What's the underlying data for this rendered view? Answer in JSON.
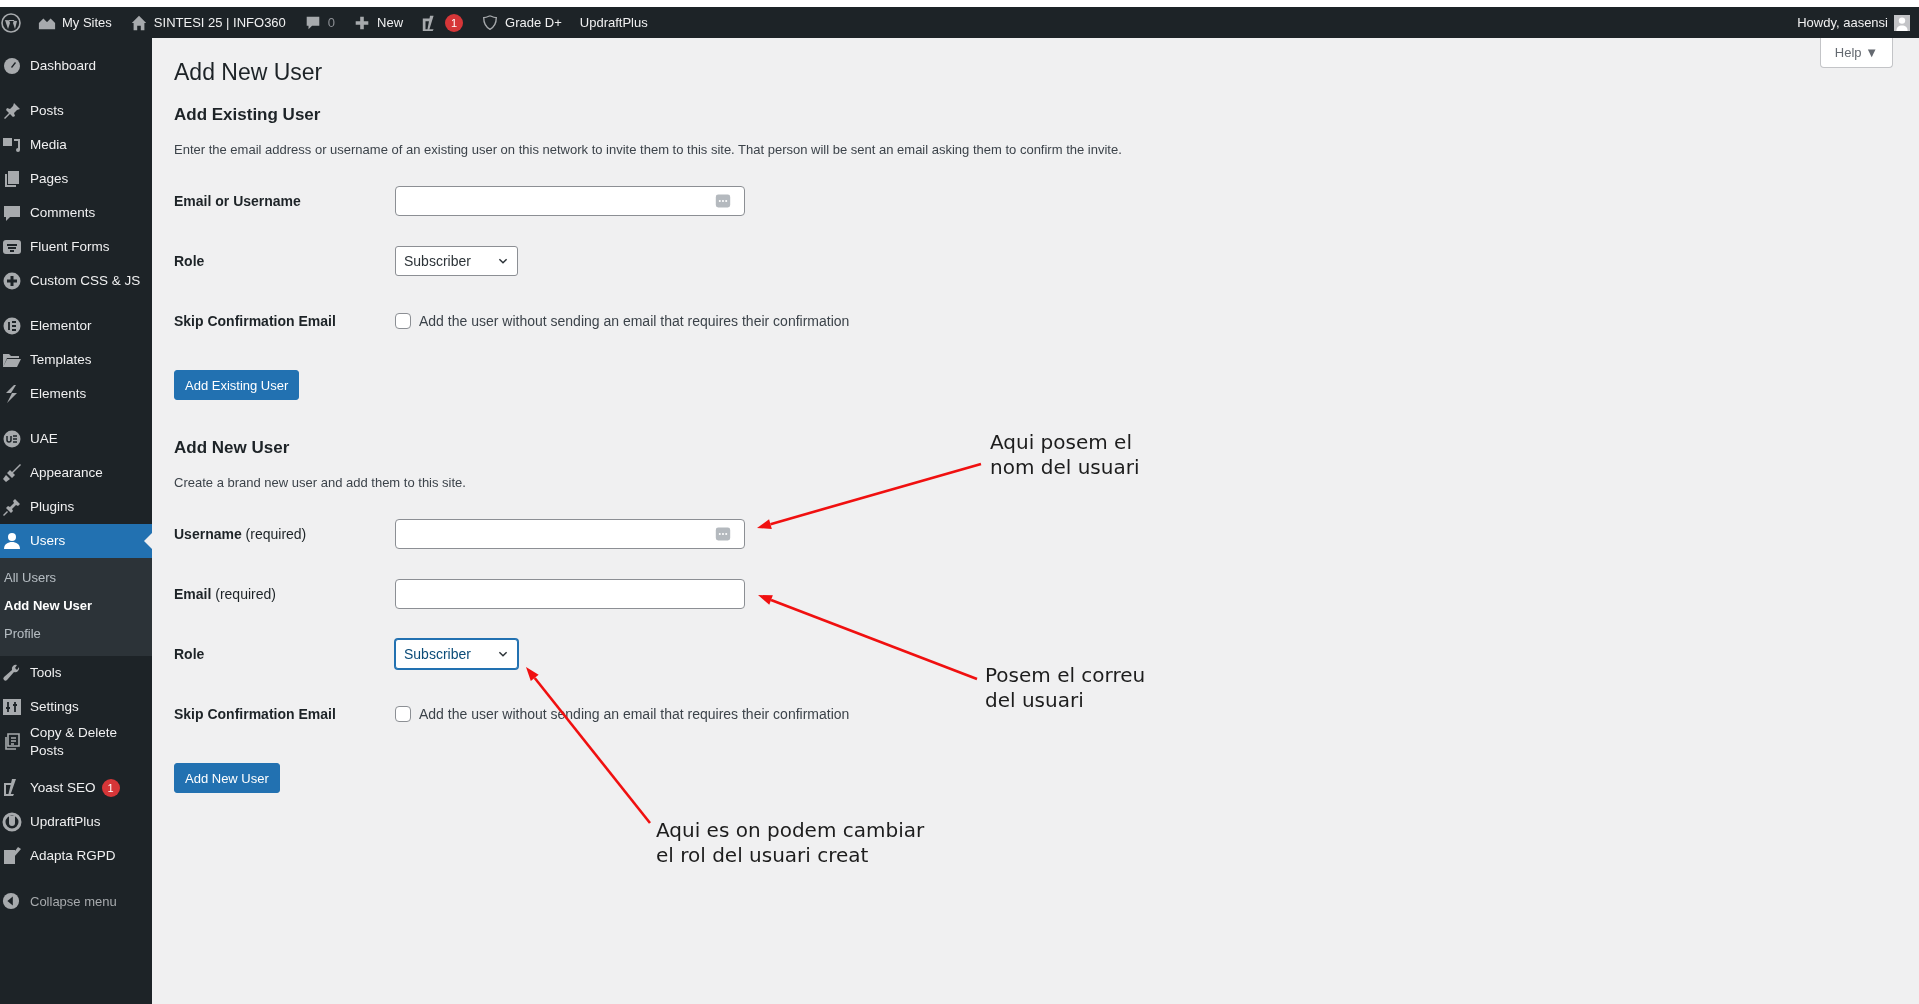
{
  "admin_bar": {
    "items": [
      {
        "kind": "logo"
      },
      {
        "kind": "link",
        "label": "My Sites"
      },
      {
        "kind": "link",
        "label": "SINTESI 25 | INFO360"
      },
      {
        "kind": "count",
        "label": "0"
      },
      {
        "kind": "link",
        "label": "New"
      },
      {
        "kind": "badge",
        "badge": "1"
      },
      {
        "kind": "link",
        "label": "Grade D+"
      },
      {
        "kind": "text",
        "label": "UpdraftPlus"
      }
    ],
    "account": "Howdy, aasensi"
  },
  "help_button": "Help ▼",
  "sidebar": {
    "groups": [
      {
        "items": [
          {
            "label": "Dashboard",
            "selected": false
          }
        ]
      },
      {
        "items": [
          {
            "label": "Posts",
            "selected": false
          },
          {
            "label": "Media",
            "selected": false
          },
          {
            "label": "Pages",
            "selected": false
          },
          {
            "label": "Comments",
            "selected": false
          },
          {
            "label": "Fluent Forms",
            "selected": false
          },
          {
            "label": "Custom CSS & JS",
            "selected": false
          }
        ]
      },
      {
        "items": [
          {
            "label": "Elementor",
            "selected": false
          },
          {
            "label": "Templates",
            "selected": false
          },
          {
            "label": "Elements",
            "selected": false
          }
        ]
      },
      {
        "items": [
          {
            "label": "UAE",
            "selected": false
          },
          {
            "label": "Appearance",
            "selected": false
          },
          {
            "label": "Plugins",
            "selected": false
          },
          {
            "label": "Users",
            "selected": true,
            "children": [
              {
                "label": "All Users",
                "selected": false
              },
              {
                "label": "Add New User",
                "selected": true
              },
              {
                "label": "Profile",
                "selected": false
              }
            ]
          },
          {
            "label": "Tools",
            "selected": false
          },
          {
            "label": "Settings",
            "selected": false
          },
          {
            "label": "Copy & Delete Posts",
            "selected": false
          }
        ]
      },
      {
        "items": [
          {
            "label": "Yoast SEO",
            "selected": false,
            "badge": "1"
          },
          {
            "label": "UpdraftPlus",
            "selected": false
          },
          {
            "label": "Adapta RGPD",
            "selected": false
          }
        ]
      }
    ],
    "collapse": "Collapse menu"
  },
  "page_title": "Add New User",
  "sections": [
    {
      "heading": "Add Existing User",
      "description": "Enter the email address or username of an existing user on this network to invite them to this site. That person will be sent an email asking them to confirm the invite.",
      "fields": [
        {
          "kind": "text",
          "label": "Email or Username",
          "dots": true
        },
        {
          "kind": "select",
          "label": "Role",
          "value": "Subscriber",
          "focused": false
        },
        {
          "kind": "checkbox",
          "label": "Skip Confirmation Email",
          "option": "Add the user without sending an email that requires their confirmation",
          "checked": false
        }
      ],
      "button": "Add Existing User"
    },
    {
      "heading": "Add New User",
      "description": "Create a brand new user and add them to this site.",
      "fields": [
        {
          "kind": "text",
          "label": "Username",
          "note": "(required)",
          "dots": true
        },
        {
          "kind": "text",
          "label": "Email",
          "note": "(required)",
          "dots": false
        },
        {
          "kind": "select",
          "label": "Role",
          "value": "Subscriber",
          "focused": true
        },
        {
          "kind": "checkbox",
          "label": "Skip Confirmation Email",
          "option": "Add the user without sending an email that requires their confirmation",
          "checked": false
        }
      ],
      "button": "Add New User"
    }
  ],
  "annotations": [
    {
      "text": "Aqui posem el\nnom del usuari"
    },
    {
      "text": "Posem el correu\ndel usuari"
    },
    {
      "text": "Aqui es on podem cambiar\nel rol del usuari creat"
    }
  ]
}
